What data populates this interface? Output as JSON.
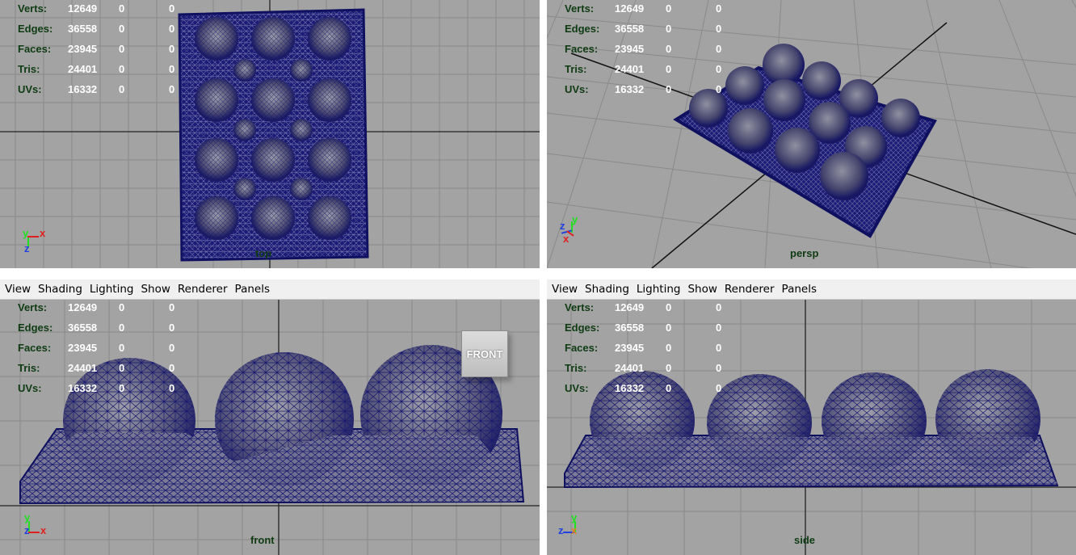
{
  "menu": [
    "View",
    "Shading",
    "Lighting",
    "Show",
    "Renderer",
    "Panels"
  ],
  "hud": {
    "rows": [
      {
        "label": "Verts:",
        "v1": "12649",
        "v2": "0",
        "v3": "0"
      },
      {
        "label": "Edges:",
        "v1": "36558",
        "v2": "0",
        "v3": "0"
      },
      {
        "label": "Faces:",
        "v1": "23945",
        "v2": "0",
        "v3": "0"
      },
      {
        "label": "Tris:",
        "v1": "24401",
        "v2": "0",
        "v3": "0"
      },
      {
        "label": "UVs:",
        "v1": "16332",
        "v2": "0",
        "v3": "0"
      }
    ]
  },
  "viewports": {
    "top": {
      "camera": "top"
    },
    "persp": {
      "camera": "persp"
    },
    "front": {
      "camera": "front",
      "cube_label": "FRONT"
    },
    "side": {
      "camera": "side"
    }
  },
  "axes": {
    "x": "x",
    "y": "y",
    "z": "z"
  },
  "colors": {
    "viewport_bg": "#a3a3a3",
    "grid": "#8a8a8a",
    "mesh": "#14146e",
    "hud_label": "#0e3b12",
    "hud_value": "#ffffff",
    "axis_x": "#e02020",
    "axis_y": "#20e020",
    "axis_z": "#2040e0"
  }
}
